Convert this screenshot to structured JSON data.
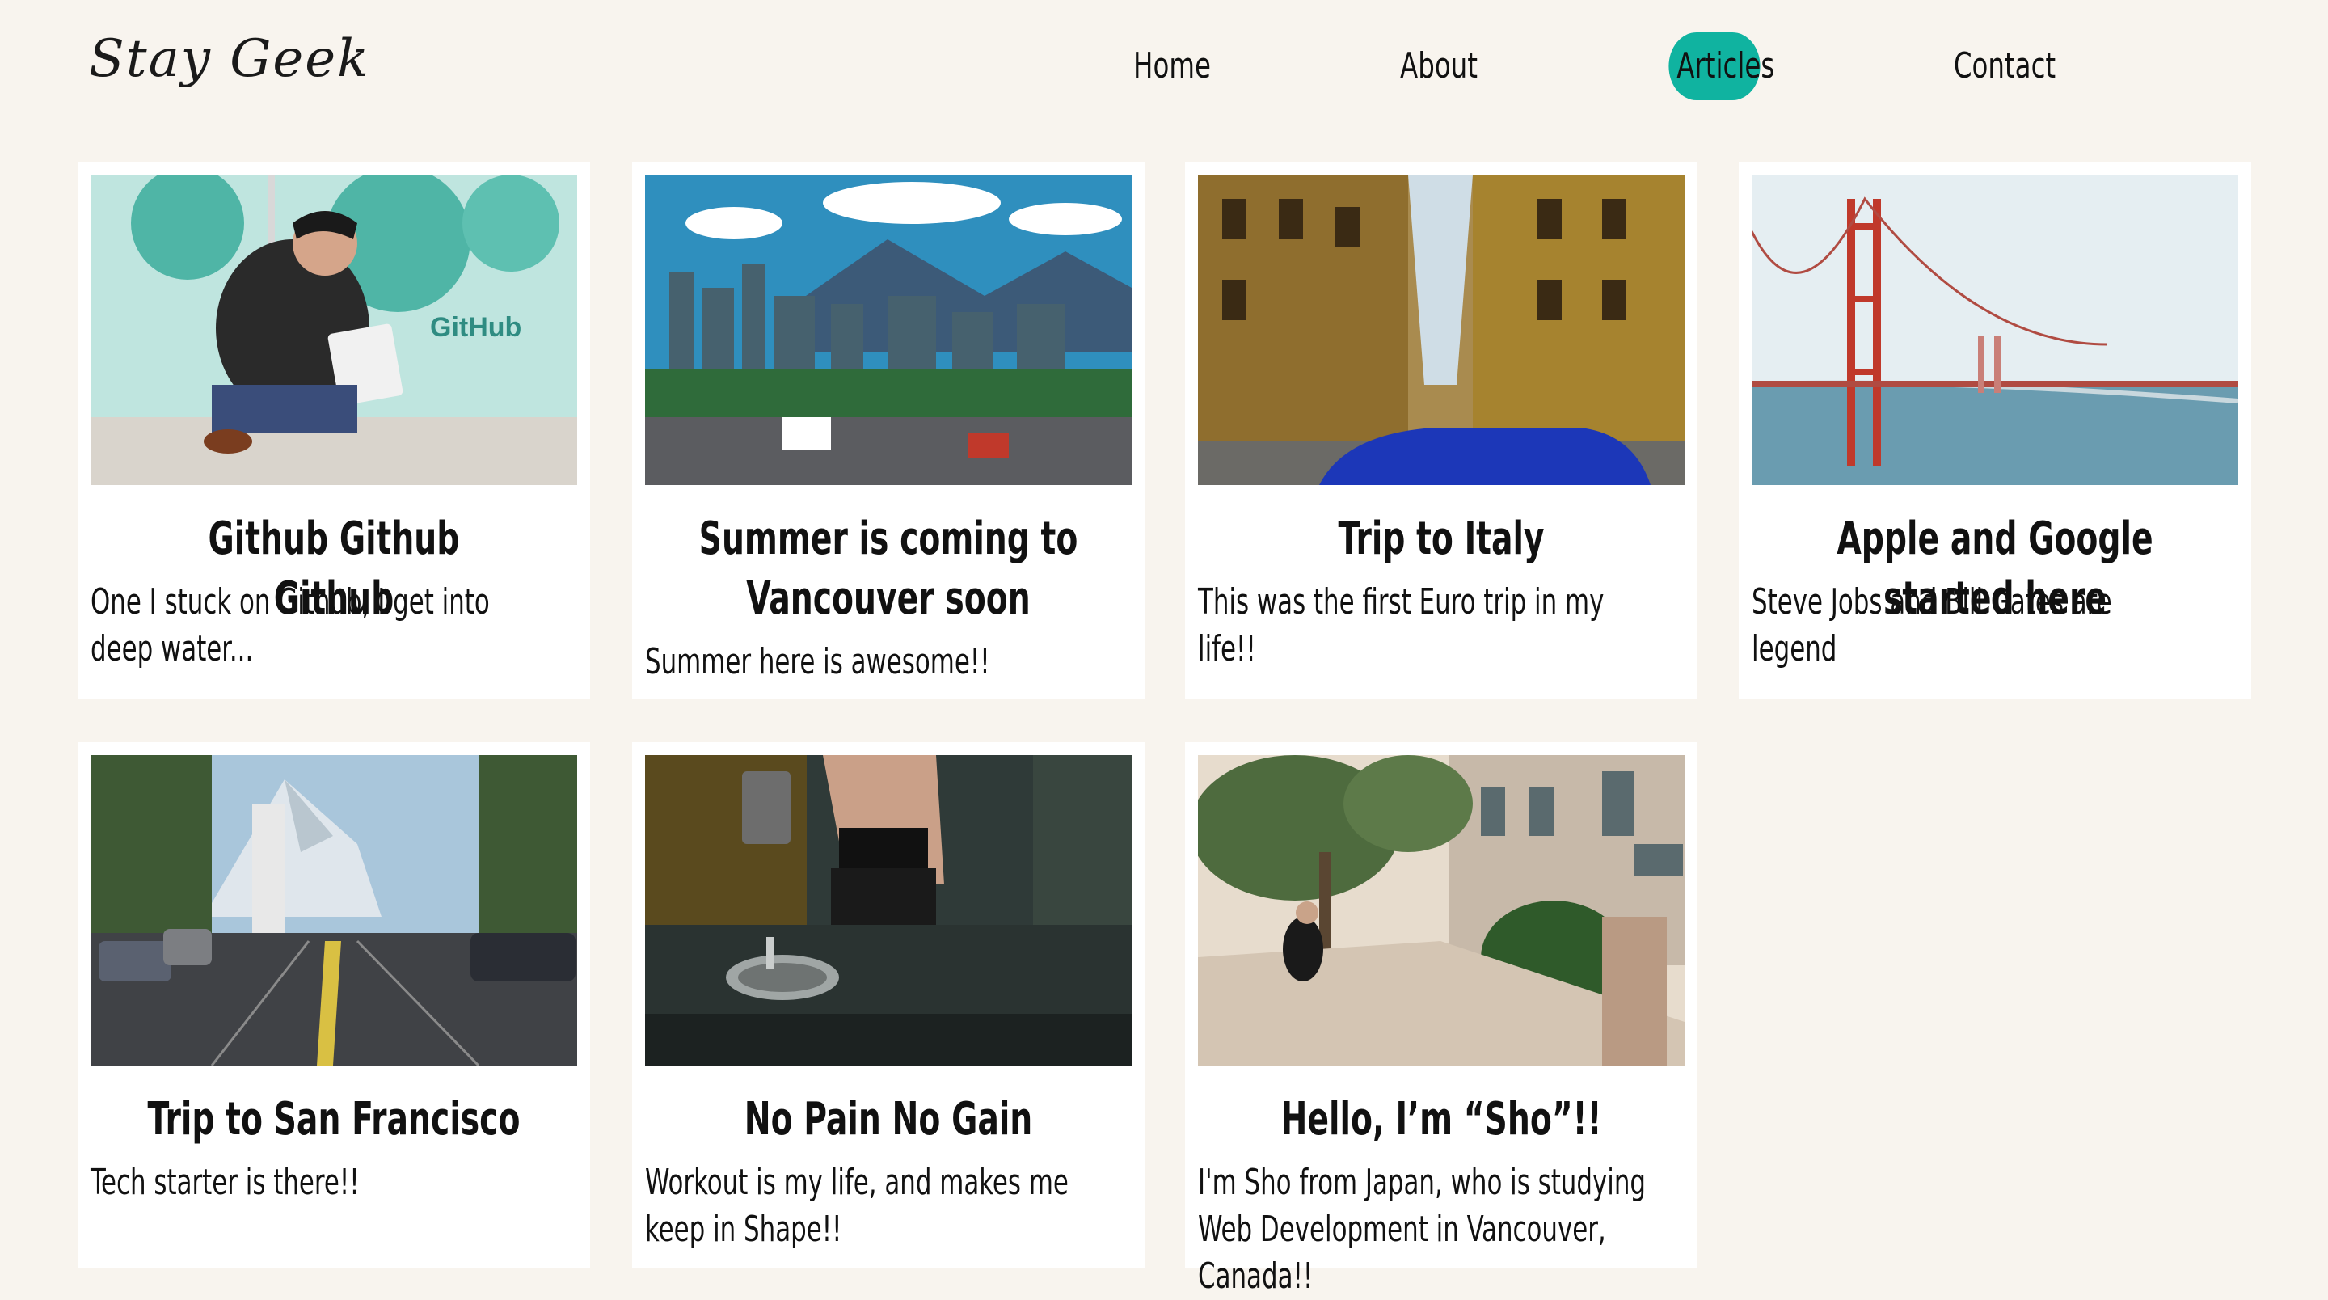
{
  "site": {
    "logo": "Stay Geek"
  },
  "nav": {
    "items": [
      {
        "label": "Home"
      },
      {
        "label": "About"
      },
      {
        "label": "Articles",
        "active": true
      },
      {
        "label": "Contact"
      }
    ]
  },
  "colors": {
    "background": "#f8f4ee",
    "card": "#ffffff",
    "accent": "#10b3a0"
  },
  "articles": [
    {
      "title": "Github Github Github",
      "desc": "One I stuck on Github, I get into deep water...",
      "image": "person-at-github-office"
    },
    {
      "title": "Summer is coming to Vancouver soon",
      "desc": "Summer here is awesome!!",
      "image": "vancouver-cityscape"
    },
    {
      "title": "Trip to Italy",
      "desc": "This was the first Euro trip in my life!!",
      "image": "italian-street"
    },
    {
      "title": "Apple and Google started here",
      "desc": "Steve Jobs and Bill Gates are legend",
      "image": "golden-gate-bridge"
    },
    {
      "title": "Trip to San Francisco",
      "desc": "Tech starter is there!!",
      "image": "san-francisco-street"
    },
    {
      "title": "No Pain No Gain",
      "desc": "Workout is my life, and makes me keep in Shape!!",
      "image": "gym-mirror-selfie"
    },
    {
      "title": "Hello, I’m “Sho”!!",
      "desc": "I'm Sho from Japan, who is studying Web Development in Vancouver, Canada!!",
      "image": "person-on-sidewalk"
    }
  ]
}
